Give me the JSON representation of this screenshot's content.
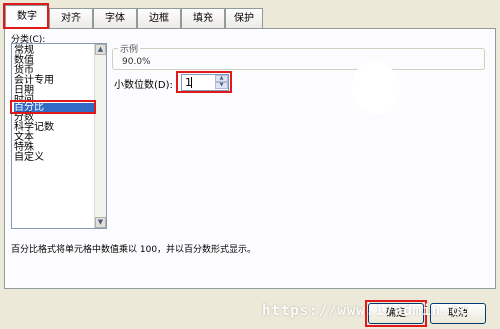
{
  "tabs": [
    {
      "label": "数字"
    },
    {
      "label": "对齐"
    },
    {
      "label": "字体"
    },
    {
      "label": "边框"
    },
    {
      "label": "填充"
    },
    {
      "label": "保护"
    }
  ],
  "category": {
    "label": "分类(C):",
    "items": [
      "常规",
      "数值",
      "货币",
      "会计专用",
      "日期",
      "时间",
      "百分比",
      "分数",
      "科学记数",
      "文本",
      "特殊",
      "自定义"
    ],
    "selected": "百分比"
  },
  "sample": {
    "title": "示例",
    "value": "90.0%"
  },
  "decimal_places": {
    "label": "小数位数(D):",
    "value": "1"
  },
  "description": "百分比格式将单元格中数值乘以 100，并以百分数形式显示。",
  "buttons": {
    "ok": "确定",
    "cancel": "取消"
  },
  "watermark": "https://www.17admin.cc",
  "colors": {
    "highlight": "#e01a1a",
    "selection": "#316ac5"
  }
}
